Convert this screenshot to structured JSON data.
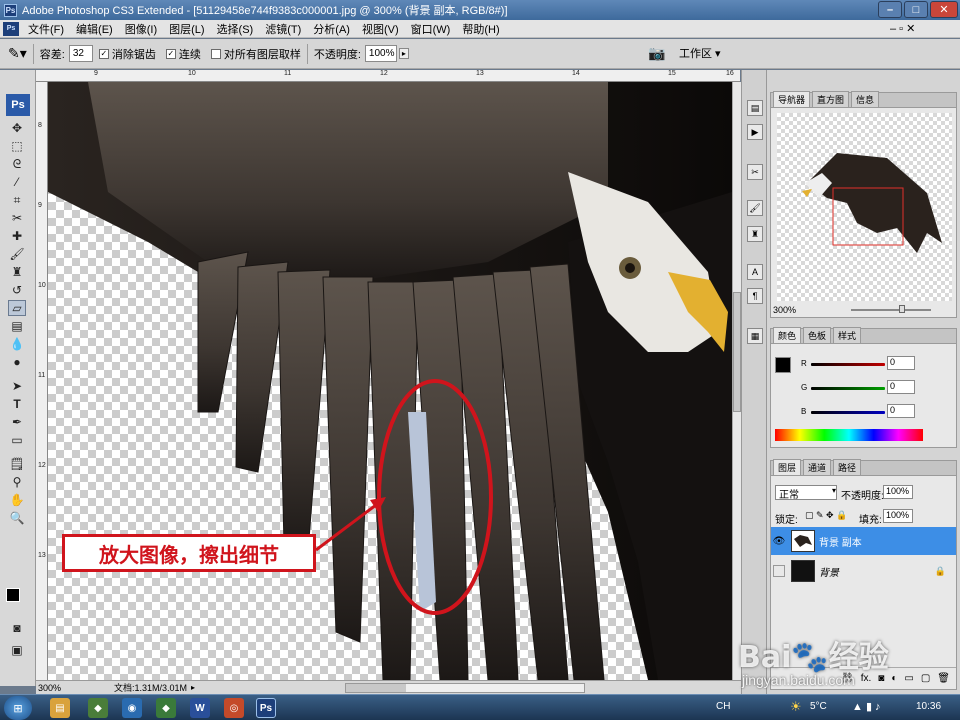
{
  "window": {
    "app_badge": "Ps",
    "title": "Adobe Photoshop CS3 Extended - [51129458e744f9383c000001.jpg @ 300% (背景 副本, RGB/8#)]"
  },
  "menu": {
    "badge": "Ps",
    "items": [
      "文件(F)",
      "编辑(E)",
      "图像(I)",
      "图层(L)",
      "选择(S)",
      "滤镜(T)",
      "分析(A)",
      "视图(V)",
      "窗口(W)",
      "帮助(H)"
    ]
  },
  "options": {
    "tolerance_label": "容差:",
    "tolerance_value": "32",
    "antialias_label": "消除锯齿",
    "contiguous_label": "连续",
    "all_layers_label": "对所有图层取样",
    "opacity_label": "不透明度:",
    "opacity_value": "100%",
    "workspace_label": "工作区"
  },
  "toolbox": {
    "badge": "Ps"
  },
  "rulers": {
    "top_ticks": [
      "9",
      "10",
      "11",
      "12",
      "13",
      "14",
      "15",
      "16"
    ],
    "left_ticks": [
      "8",
      "9",
      "10",
      "11",
      "12",
      "13"
    ]
  },
  "canvas": {
    "annotation_text": "放大图像，擦出细节",
    "accent_red": "#d0141c"
  },
  "status": {
    "zoom": "300%",
    "doc_size": "文档:1.31M/3.01M"
  },
  "navigator": {
    "tabs": [
      "导航器",
      "直方图",
      "信息"
    ],
    "zoom": "300%"
  },
  "color": {
    "tabs": [
      "颜色",
      "色板",
      "样式"
    ],
    "channels": [
      {
        "label": "R",
        "value": "0",
        "color": "#c00000"
      },
      {
        "label": "G",
        "value": "0",
        "color": "#00a000"
      },
      {
        "label": "B",
        "value": "0",
        "color": "#0000c0"
      }
    ]
  },
  "layers": {
    "tabs": [
      "图层",
      "通道",
      "路径"
    ],
    "blend_mode": "正常",
    "opacity_label": "不透明度:",
    "opacity_value": "100%",
    "lock_label": "锁定:",
    "fill_label": "填充:",
    "fill_value": "100%",
    "items": [
      {
        "name": "背景 副本",
        "selected": true,
        "visible": true
      },
      {
        "name": "背景",
        "selected": false,
        "visible": false,
        "locked": true
      }
    ],
    "footer_fx": "fx."
  },
  "taskbar": {
    "ime": "CH",
    "temperature": "5°C",
    "time": "10:36"
  },
  "watermark": {
    "brand": "Bai",
    "brand2": "经验",
    "url": "jingyan.baidu.com"
  }
}
